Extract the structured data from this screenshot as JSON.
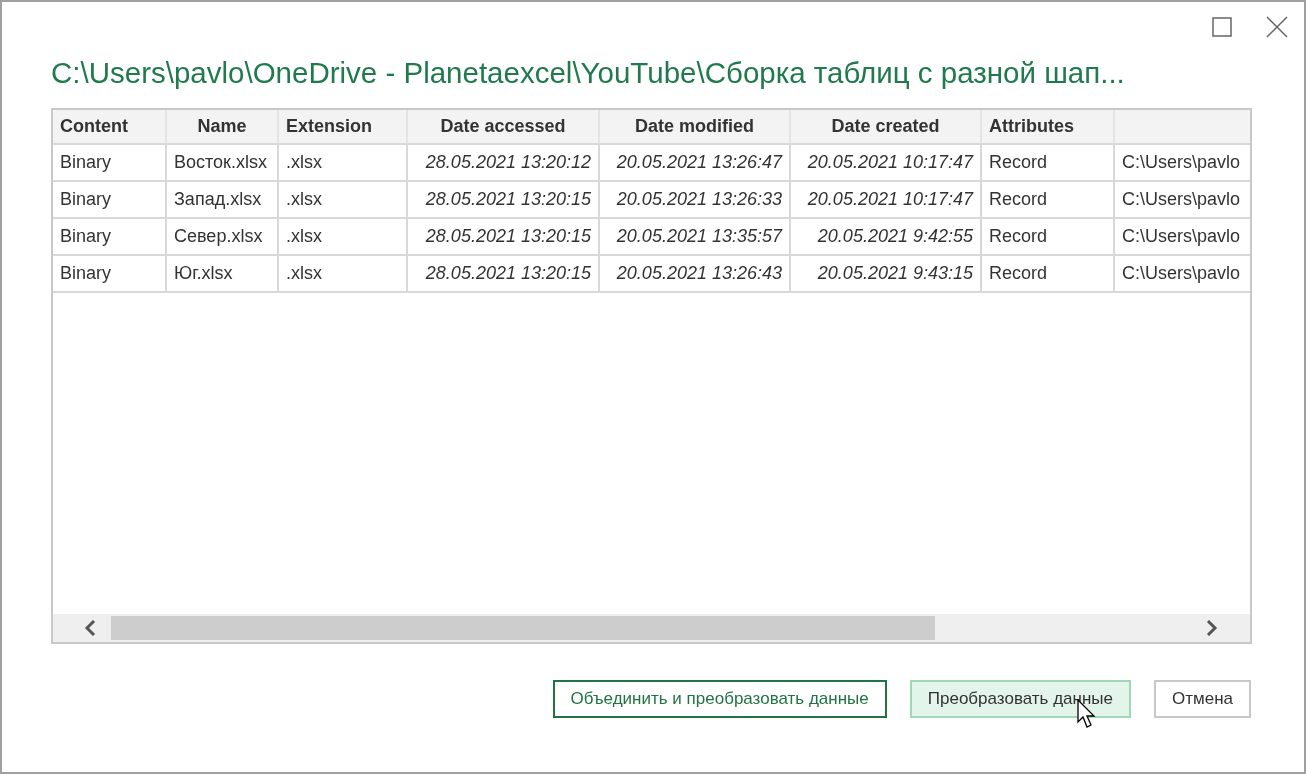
{
  "window": {
    "title": "C:\\Users\\pavlo\\OneDrive - Planetaexcel\\YouTube\\Сборка таблиц с разной шап..."
  },
  "table": {
    "columns": [
      {
        "label": "Content",
        "kind": "text"
      },
      {
        "label": "Name",
        "kind": "text"
      },
      {
        "label": "Extension",
        "kind": "text"
      },
      {
        "label": "Date accessed",
        "kind": "date"
      },
      {
        "label": "Date modified",
        "kind": "date"
      },
      {
        "label": "Date created",
        "kind": "date"
      },
      {
        "label": "Attributes",
        "kind": "text"
      },
      {
        "kind": "text"
      }
    ],
    "rows": [
      [
        "Binary",
        "Восток.xlsx",
        ".xlsx",
        "28.05.2021 13:20:12",
        "20.05.2021 13:26:47",
        "20.05.2021 10:17:47",
        "Record",
        "C:\\Users\\pavlo"
      ],
      [
        "Binary",
        "Запад.xlsx",
        ".xlsx",
        "28.05.2021 13:20:15",
        "20.05.2021 13:26:33",
        "20.05.2021 10:17:47",
        "Record",
        "C:\\Users\\pavlo"
      ],
      [
        "Binary",
        "Север.xlsx",
        ".xlsx",
        "28.05.2021 13:20:15",
        "20.05.2021 13:35:57",
        "20.05.2021 9:42:55",
        "Record",
        "C:\\Users\\pavlo"
      ],
      [
        "Binary",
        "Юг.xlsx",
        ".xlsx",
        "28.05.2021 13:20:15",
        "20.05.2021 13:26:43",
        "20.05.2021 9:43:15",
        "Record",
        "C:\\Users\\pavlo"
      ]
    ]
  },
  "buttons": [
    {
      "label": "Объединить и преобразовать данные",
      "kind": "outlined"
    },
    {
      "label": "Преобразовать данные",
      "kind": "hovered"
    },
    {
      "label": "Отмена",
      "kind": "default"
    }
  ]
}
